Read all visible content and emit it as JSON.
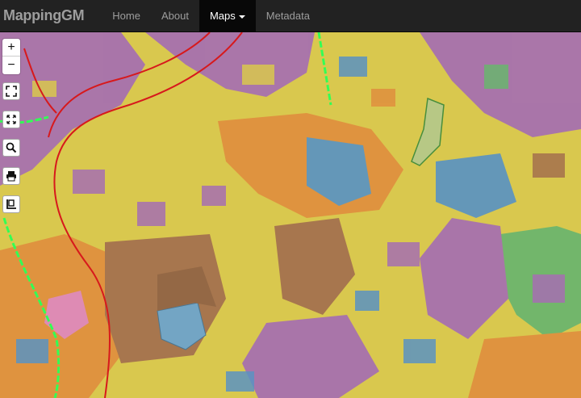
{
  "navbar": {
    "brand": "MappingGM",
    "items": [
      {
        "label": "Home",
        "active": false
      },
      {
        "label": "About",
        "active": false
      },
      {
        "label": "Maps",
        "active": true,
        "dropdown": true
      },
      {
        "label": "Metadata",
        "active": false
      }
    ]
  },
  "controls": {
    "zoom_in": "+",
    "zoom_out": "−",
    "icons": [
      "fullscreen-icon",
      "fit-extent-icon",
      "search-icon",
      "print-icon",
      "layers-icon"
    ]
  },
  "map": {
    "colors": {
      "purple": "#a66fb1",
      "yellow": "#d9c84e",
      "orange": "#e08f3e",
      "blue": "#5b93c2",
      "brown": "#a3704e",
      "green": "#6ab56e",
      "pink": "#df86bd",
      "boundary": "#d7191c",
      "route": "#33ff55"
    }
  }
}
